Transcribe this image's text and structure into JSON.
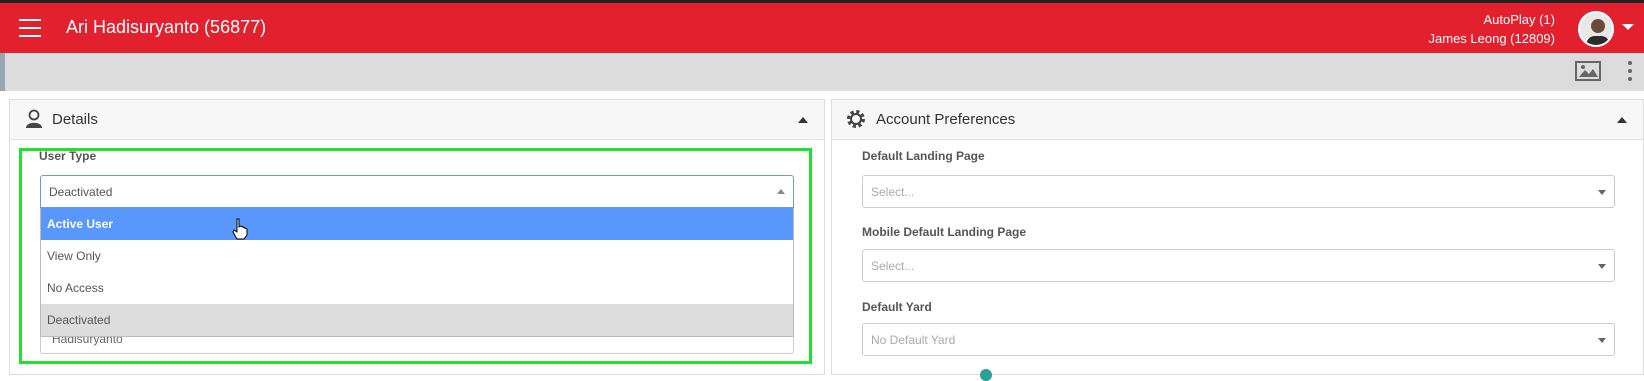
{
  "header": {
    "title": "Ari Hadisuryanto (56877)",
    "autoplay": "AutoPlay (1)",
    "logged_user": "James Leong (12809)",
    "bg_color": "#e3202e"
  },
  "details": {
    "title": "Details",
    "user_type_label": "User Type",
    "user_type_value": "Deactivated",
    "options": [
      "Active User",
      "View Only",
      "No Access",
      "Deactivated"
    ],
    "hovered_option": "Active User",
    "partial_field_value": "Hadisuryanto"
  },
  "preferences": {
    "title": "Account Preferences",
    "landing_label": "Default Landing Page",
    "landing_placeholder": "Select...",
    "mobile_label": "Mobile Default Landing Page",
    "mobile_placeholder": "Select...",
    "yard_label": "Default Yard",
    "yard_value": "No Default Yard"
  },
  "colors": {
    "highlight": "#22e12a",
    "option_active": "#5897fb"
  }
}
